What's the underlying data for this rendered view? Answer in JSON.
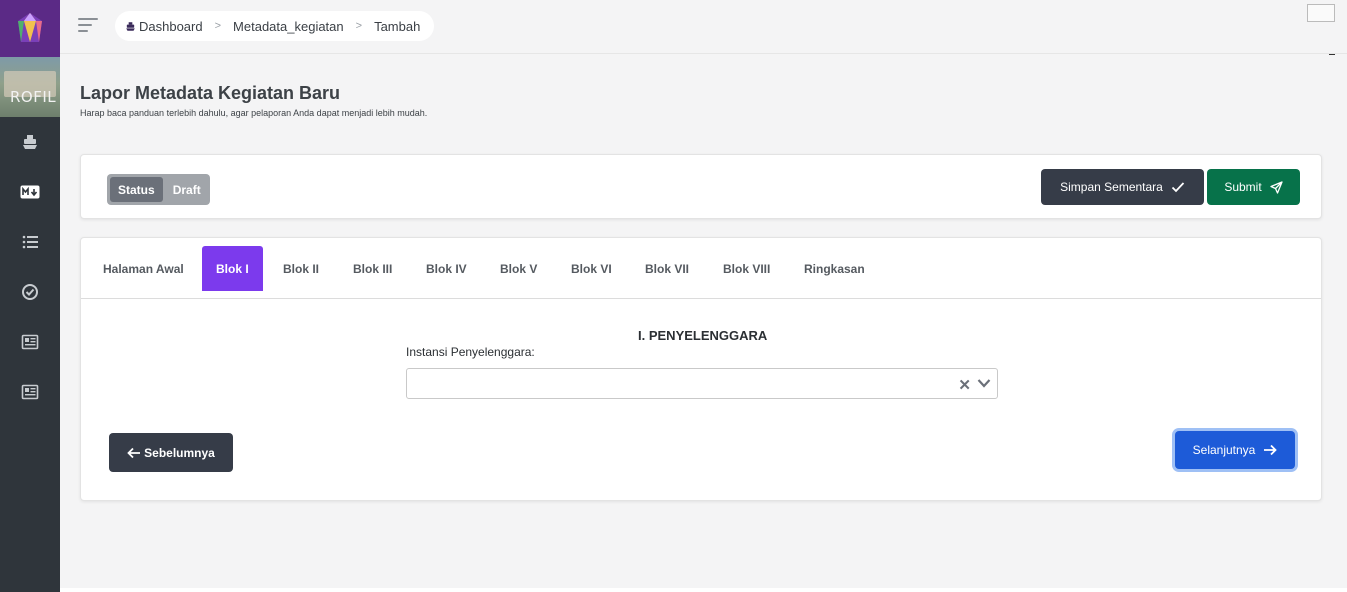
{
  "breadcrumb": {
    "items": [
      "Dashboard",
      "Metadata_kegiatan",
      "Tambah"
    ]
  },
  "sidebar": {
    "profile_text": "ROFIL",
    "icons": [
      "ship-icon",
      "markdown-icon",
      "list-icon",
      "check-circle-icon",
      "newspaper-icon",
      "newspaper-icon"
    ]
  },
  "page": {
    "title": "Lapor Metadata Kegiatan Baru",
    "subtitle": "Harap baca panduan terlebih dahulu, agar pelaporan Anda dapat menjadi lebih mudah."
  },
  "status": {
    "label": "Status",
    "value": "Draft"
  },
  "actions": {
    "save_label": "Simpan Sementara",
    "submit_label": "Submit"
  },
  "tabs": [
    {
      "label": "Halaman Awal",
      "active": false
    },
    {
      "label": "Blok I",
      "active": true
    },
    {
      "label": "Blok II",
      "active": false
    },
    {
      "label": "Blok III",
      "active": false
    },
    {
      "label": "Blok IV",
      "active": false
    },
    {
      "label": "Blok V",
      "active": false
    },
    {
      "label": "Blok VI",
      "active": false
    },
    {
      "label": "Blok VII",
      "active": false
    },
    {
      "label": "Blok VIII",
      "active": false
    },
    {
      "label": "Ringkasan",
      "active": false
    }
  ],
  "form": {
    "section_title": "I. PENYELENGGARA",
    "field_label": "Instansi Penyelenggara:",
    "field_value": ""
  },
  "nav": {
    "prev_label": "Sebelumnya",
    "next_label": "Selanjutnya"
  },
  "colors": {
    "accent": "#7c3aed",
    "logo_bg": "#5b2a86",
    "sidebar_bg": "#2f353b",
    "save_bg": "#363c48",
    "submit_bg": "#07724a",
    "next_bg": "#1d5bd8"
  }
}
